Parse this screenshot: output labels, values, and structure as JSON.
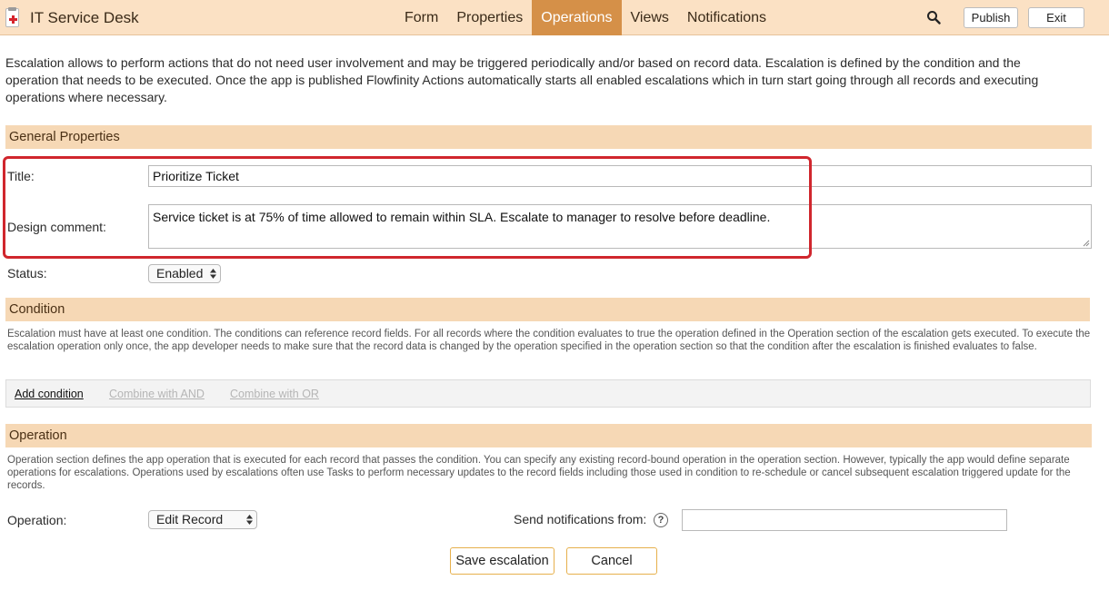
{
  "app": {
    "title": "IT Service Desk"
  },
  "nav": {
    "tabs": [
      {
        "label": "Form"
      },
      {
        "label": "Properties"
      },
      {
        "label": "Operations"
      },
      {
        "label": "Views"
      },
      {
        "label": "Notifications"
      }
    ],
    "active": "Operations"
  },
  "toolbar": {
    "publish_label": "Publish",
    "exit_label": "Exit"
  },
  "intro": "Escalation allows to perform actions that do not need user involvement and may be triggered periodically and/or based on record data. Escalation is defined by the condition and the operation that needs to be executed. Once the app is published Flowfinity Actions automatically starts all enabled escalations which in turn start going through all records and executing operations where necessary.",
  "general": {
    "header": "General Properties",
    "title_label": "Title:",
    "title_value": "Prioritize Ticket",
    "comment_label": "Design comment:",
    "comment_value": "Service ticket is at 75% of time allowed to remain within SLA. Escalate to manager to resolve before deadline.",
    "status_label": "Status:",
    "status_value": "Enabled"
  },
  "condition": {
    "header": "Condition",
    "description": "Escalation must have at least one condition. The conditions can reference record fields. For all records where the condition evaluates to true the operation defined in the Operation section of the escalation gets executed. To execute the escalation operation only once, the app developer needs to make sure that the record data is changed by the operation specified in the operation section so that the condition after the escalation is finished evaluates to false.",
    "add_label": "Add condition",
    "and_label": "Combine with AND",
    "or_label": "Combine with OR"
  },
  "operation": {
    "header": "Operation",
    "description": "Operation section defines the app operation that is executed for each record that passes the condition. You can specify any existing record-bound operation in the operation section. However, typically the app would define separate operations for escalations. Operations used by escalations often use Tasks to perform necessary updates to the record fields including those used in condition to re-schedule or cancel subsequent escalation triggered update for the records.",
    "operation_label": "Operation:",
    "operation_value": "Edit Record",
    "notifications_label": "Send notifications from:",
    "notifications_value": "",
    "help_glyph": "?"
  },
  "actions": {
    "save_label": "Save escalation",
    "cancel_label": "Cancel"
  },
  "colors": {
    "topbar_bg": "#fbe1c4",
    "active_tab": "#d59048",
    "section_bg": "#f6d8b5",
    "highlight": "#d0262d",
    "button_border": "#e6b04c"
  },
  "icons": {
    "app": "medical-kit-icon",
    "search": "search-icon",
    "help": "help-icon"
  }
}
